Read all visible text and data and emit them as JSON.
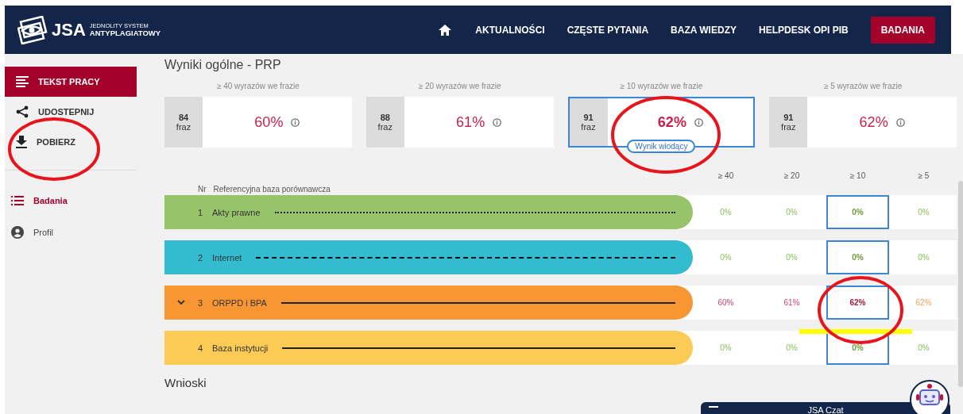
{
  "logo": {
    "name": "JSA",
    "line1": "JEDNOLITY SYSTEM",
    "line2": "ANTYPLAGIATOWY"
  },
  "nav": [
    {
      "label": "AKTUALNOŚCI",
      "selected": false
    },
    {
      "label": "CZĘSTE PYTANIA",
      "selected": false
    },
    {
      "label": "BAZA WIEDZY",
      "selected": false
    },
    {
      "label": "HELPDESK OPI PIB",
      "selected": false
    },
    {
      "label": "BADANIA",
      "selected": true
    }
  ],
  "sidebar": {
    "actions": [
      {
        "label": "TEKST PRACY",
        "kind": "text",
        "selected": true
      },
      {
        "label": "UDOSTEPNIJ",
        "kind": "share",
        "selected": false
      },
      {
        "label": "POBIERZ",
        "kind": "download",
        "selected": false
      }
    ],
    "links": [
      {
        "label": "Badania",
        "kind": "list",
        "selected": true
      },
      {
        "label": "Profil",
        "kind": "profile",
        "selected": false
      }
    ]
  },
  "title": "Wyniki ogólne - PRP",
  "cards": [
    {
      "heading": "≥ 40 wyrazów we frazie",
      "count": "84",
      "unit": "fraz",
      "percent": "60%",
      "selected": false
    },
    {
      "heading": "≥ 20 wyrazów we frazie",
      "count": "88",
      "unit": "fraz",
      "percent": "61%",
      "selected": false
    },
    {
      "heading": "≥ 10 wyrazów we frazie",
      "count": "91",
      "unit": "fraz",
      "percent": "62%",
      "selected": true,
      "badge": "Wynik wiodący"
    },
    {
      "heading": "≥ 5 wyrazów we frazie",
      "count": "91",
      "unit": "fraz",
      "percent": "62%",
      "selected": false
    }
  ],
  "table": {
    "nr_heading": "Nr",
    "name_heading": "Referencyjna baza porównawcza",
    "columns": [
      {
        "label": "≥ 40",
        "selected": false
      },
      {
        "label": "≥ 20",
        "selected": false
      },
      {
        "label": "≥ 10",
        "selected": true
      },
      {
        "label": "≥ 5",
        "selected": false
      }
    ],
    "rows": [
      {
        "nr": "1",
        "name": "Akty prawne",
        "color": "#97c46a",
        "kind": "dotted",
        "expandable": false,
        "values": [
          {
            "text": "0%",
            "kind": "zero"
          },
          {
            "text": "0%",
            "kind": "zero"
          },
          {
            "text": "0%",
            "kind": "zero"
          },
          {
            "text": "0%",
            "kind": "zero"
          }
        ]
      },
      {
        "nr": "2",
        "name": "Internet",
        "color": "#33bccf",
        "kind": "dashed",
        "expandable": false,
        "values": [
          {
            "text": "0%",
            "kind": "zero"
          },
          {
            "text": "0%",
            "kind": "zero"
          },
          {
            "text": "0%",
            "kind": "zero"
          },
          {
            "text": "0%",
            "kind": "zero"
          }
        ]
      },
      {
        "nr": "3",
        "name": "ORPPD i BPA",
        "color": "#f79633",
        "kind": "solid",
        "expandable": true,
        "values": [
          {
            "text": "60%",
            "kind": "high"
          },
          {
            "text": "61%",
            "kind": "high"
          },
          {
            "text": "62%",
            "kind": "high"
          },
          {
            "text": "62%",
            "kind": "medium"
          }
        ]
      },
      {
        "nr": "4",
        "name": "Baza instytucji",
        "color": "#fccb55",
        "kind": "solid",
        "expandable": false,
        "values": [
          {
            "text": "0%",
            "kind": "zero"
          },
          {
            "text": "0%",
            "kind": "zero"
          },
          {
            "text": "0%",
            "kind": "zero"
          },
          {
            "text": "0%",
            "kind": "zero"
          }
        ]
      }
    ]
  },
  "section": "Wnioski",
  "chat": {
    "title": "JSA Czat"
  }
}
